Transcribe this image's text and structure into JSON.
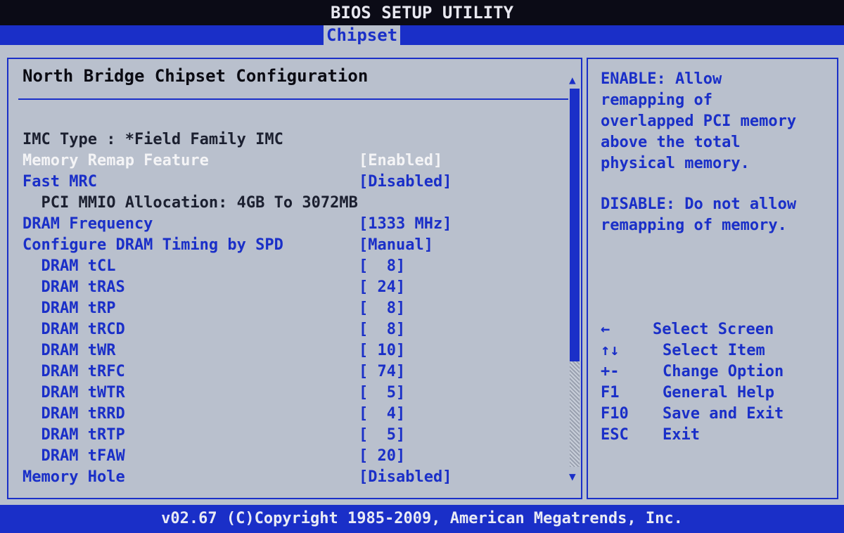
{
  "app": {
    "title": "BIOS SETUP UTILITY",
    "active_tab": "Chipset"
  },
  "main": {
    "heading": "North Bridge Chipset Configuration",
    "imc_type": "IMC Type : *Field Family IMC",
    "settings": [
      {
        "label": "Memory Remap Feature",
        "value": "[Enabled]",
        "state": "selected"
      },
      {
        "label": "Fast MRC",
        "value": "[Disabled]",
        "state": "editable"
      },
      {
        "label": "  PCI MMIO Allocation: 4GB To 3072MB",
        "value": "",
        "state": "info"
      },
      {
        "label": "DRAM Frequency",
        "value": "[1333 MHz]",
        "state": "editable"
      },
      {
        "label": "Configure DRAM Timing by SPD",
        "value": "[Manual]",
        "state": "editable"
      },
      {
        "label": "  DRAM tCL",
        "value": "[  8]",
        "state": "editable"
      },
      {
        "label": "  DRAM tRAS",
        "value": "[ 24]",
        "state": "editable"
      },
      {
        "label": "  DRAM tRP",
        "value": "[  8]",
        "state": "editable"
      },
      {
        "label": "  DRAM tRCD",
        "value": "[  8]",
        "state": "editable"
      },
      {
        "label": "  DRAM tWR",
        "value": "[ 10]",
        "state": "editable"
      },
      {
        "label": "  DRAM tRFC",
        "value": "[ 74]",
        "state": "editable"
      },
      {
        "label": "  DRAM tWTR",
        "value": "[  5]",
        "state": "editable"
      },
      {
        "label": "  DRAM tRRD",
        "value": "[  4]",
        "state": "editable"
      },
      {
        "label": "  DRAM tRTP",
        "value": "[  5]",
        "state": "editable"
      },
      {
        "label": "  DRAM tFAW",
        "value": "[ 20]",
        "state": "editable"
      },
      {
        "label": "Memory Hole",
        "value": "[Disabled]",
        "state": "editable"
      }
    ]
  },
  "help": {
    "enable_text": "ENABLE: Allow\nremapping of\noverlapped PCI memory\nabove the total\nphysical memory.",
    "disable_text": "DISABLE: Do not allow\nremapping of memory.",
    "keys": [
      {
        "key": "←",
        "desc": "Select Screen"
      },
      {
        "key": "↑↓",
        "desc": "Select Item"
      },
      {
        "key": "+-",
        "desc": "Change Option"
      },
      {
        "key": "F1",
        "desc": "General Help"
      },
      {
        "key": "F10",
        "desc": "Save and Exit"
      },
      {
        "key": "ESC",
        "desc": "Exit"
      }
    ]
  },
  "scroll": {
    "up_glyph": "▲",
    "down_glyph": "▼"
  },
  "footer": {
    "copyright": "v02.67 (C)Copyright 1985-2009, American Megatrends, Inc."
  },
  "colors": {
    "accent_blue": "#1a2fc8",
    "panel_gray": "#b9c0cd",
    "highlight_white": "#f4f4f6"
  }
}
